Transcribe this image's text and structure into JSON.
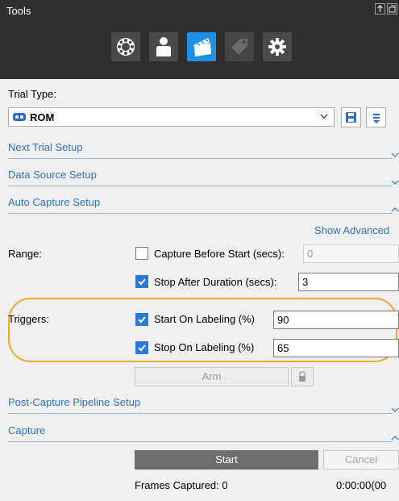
{
  "panel": {
    "title": "Tools"
  },
  "toolbar": {
    "icons": [
      "film-reel-icon",
      "person-icon",
      "clapperboard-icon",
      "tag-icon",
      "gear-icon"
    ],
    "active_icon": "clapperboard-icon"
  },
  "trial_type": {
    "label": "Trial Type:",
    "value": "ROM"
  },
  "sections": {
    "next_trial": "Next Trial Setup",
    "data_source": "Data Source Setup",
    "auto_capture": "Auto Capture Setup",
    "post_capture": "Post-Capture Pipeline Setup",
    "capture": "Capture"
  },
  "show_advanced": "Show Advanced",
  "range": {
    "label": "Range:",
    "capture_before_start": {
      "label": "Capture Before Start (secs):",
      "checked": false,
      "value": "0"
    },
    "stop_after_duration": {
      "label": "Stop After Duration (secs):",
      "checked": true,
      "value": "3"
    }
  },
  "triggers": {
    "label": "Triggers:",
    "start_on_labeling": {
      "label": "Start On Labeling (%)",
      "checked": true,
      "value": "90"
    },
    "stop_on_labeling": {
      "label": "Stop On Labeling (%)",
      "checked": true,
      "value": "65"
    }
  },
  "arm_button": "Arm",
  "start_button": "Start",
  "cancel_button": "Cancel",
  "frames_captured": "Frames Captured: 0",
  "timecode": "0:00:00(00",
  "colors": {
    "accent": "#2a78d7",
    "highlight": "#f2a52b",
    "header": "#2f2f2f"
  }
}
